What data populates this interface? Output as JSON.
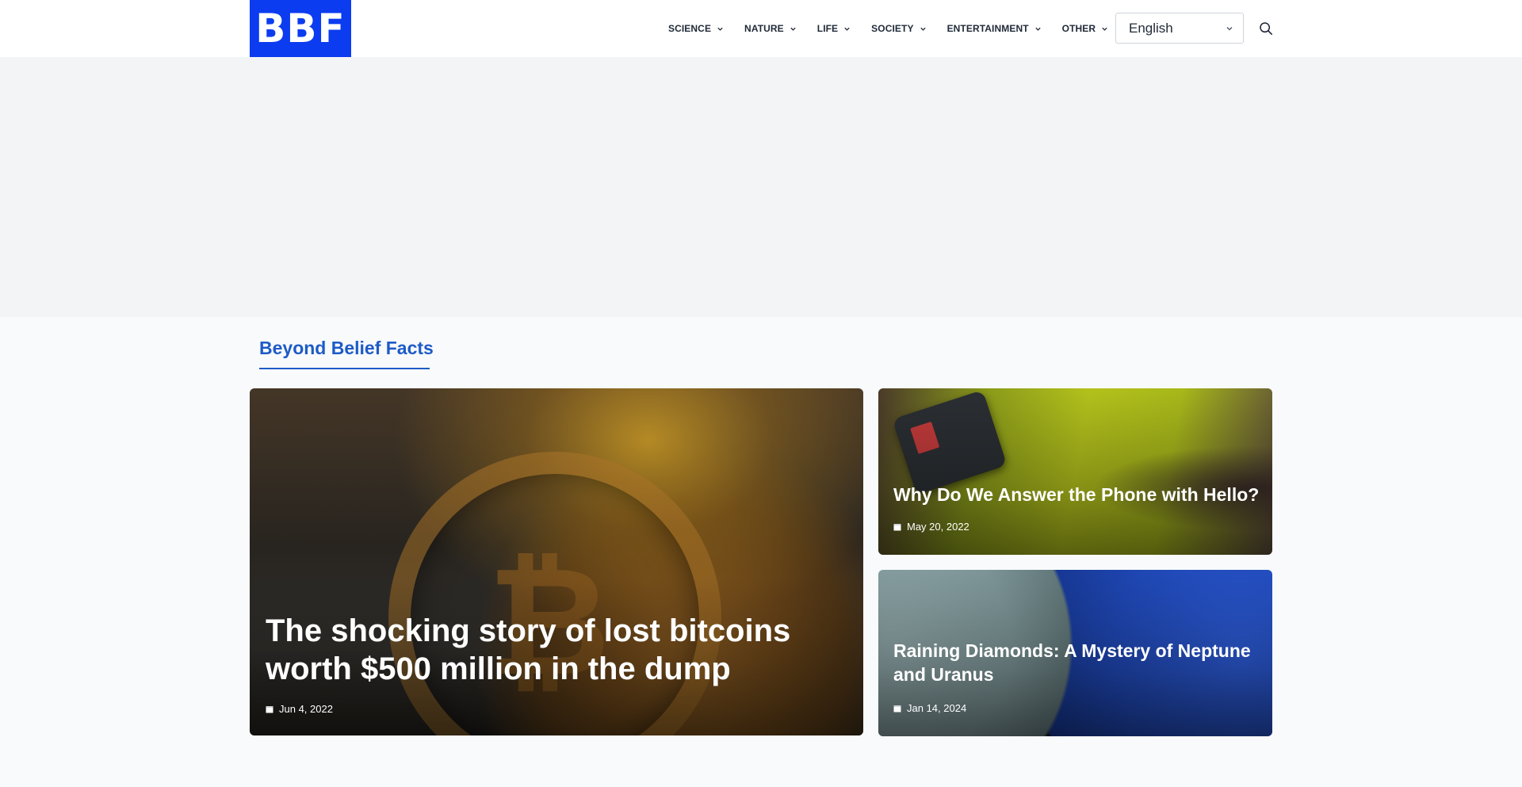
{
  "header": {
    "logo_text": "BBF",
    "nav": [
      {
        "label": "SCIENCE"
      },
      {
        "label": "NATURE"
      },
      {
        "label": "LIFE"
      },
      {
        "label": "SOCIETY"
      },
      {
        "label": "ENTERTAINMENT"
      },
      {
        "label": "OTHER"
      }
    ],
    "language": {
      "selected": "English"
    },
    "icons": {
      "search": "search-icon",
      "dropdown": "chevron-down-icon"
    }
  },
  "section": {
    "title": "Beyond Belief Facts"
  },
  "articles": [
    {
      "title": "The shocking story of lost bitcoins worth $500 million in the dump",
      "date": "Jun 4, 2022"
    },
    {
      "title": "Why Do We Answer the Phone with Hello?",
      "date": "May 20, 2022"
    },
    {
      "title": "Raining Diamonds: A Mystery of Neptune and Uranus",
      "date": "Jan 14, 2024"
    }
  ],
  "colors": {
    "brand": "#0b3cf0",
    "section_accent": "#1e5bc6",
    "ad_band": "#f3f4f6"
  }
}
